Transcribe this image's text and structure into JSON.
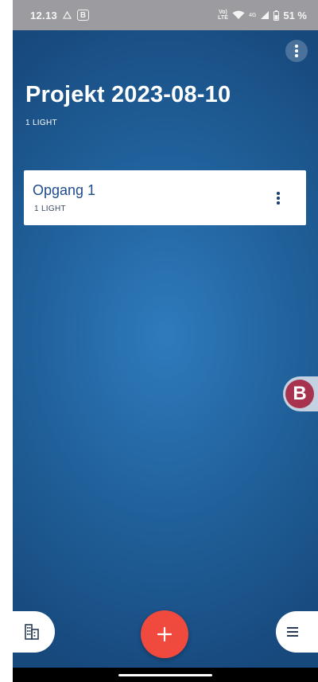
{
  "status_bar": {
    "time": "12.13",
    "badge_letter": "B",
    "volte_label": "Vo) LTE",
    "network_label": "4G",
    "battery": "51 %"
  },
  "project": {
    "title": "Projekt 2023-08-10",
    "subtitle": "1 LIGHT"
  },
  "groups": [
    {
      "name": "Opgang 1",
      "subtitle": "1 LIGHT"
    }
  ],
  "floating_badge": {
    "letter": "B"
  },
  "colors": {
    "background": "#1e5c95",
    "fab": "#f04a3e",
    "card_title": "#1e4c8a",
    "floating_badge": "#a7334e",
    "status_bar": "#9c9ca0"
  },
  "icons": {
    "overflow_menu": "more-vertical-icon",
    "fab": "plus-icon",
    "left_pill": "building-icon",
    "right_pill": "menu-icon",
    "wifi": "wifi-icon",
    "signal": "signal-icon",
    "battery": "battery-icon"
  }
}
